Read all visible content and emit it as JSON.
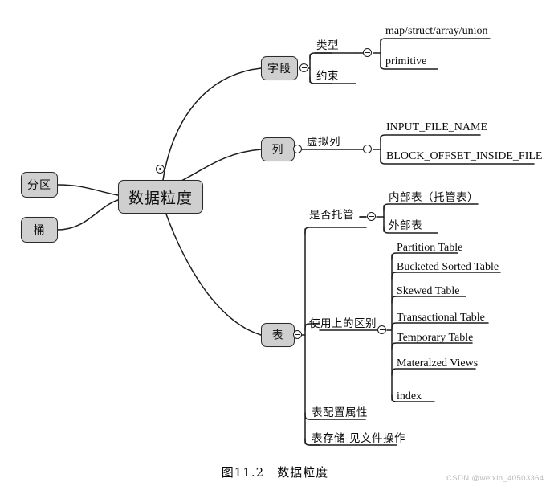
{
  "figure": {
    "caption_number": "图11.2",
    "caption_title": "数据粒度",
    "watermark": "CSDN @weixin_40503364"
  },
  "colors": {
    "node_fill": "#cfcfcf",
    "node_border": "#2b2b2b",
    "line": "#1d1d1d",
    "text": "#0c0c0c",
    "watermark": "#b8b8b8",
    "background": "#ffffff"
  },
  "mindmap": {
    "root": {
      "label": "数据粒度"
    },
    "left_branches": [
      {
        "label": "分区"
      },
      {
        "label": "桶"
      }
    ],
    "right_branches": [
      {
        "label": "字段",
        "children": [
          {
            "label": "类型",
            "children": [
              {
                "label": "map/struct/array/union"
              },
              {
                "label": "primitive"
              }
            ]
          },
          {
            "label": "约束",
            "children": []
          }
        ]
      },
      {
        "label": "列",
        "children": [
          {
            "label": "虚拟列",
            "children": [
              {
                "label": "INPUT_FILE_NAME"
              },
              {
                "label": "BLOCK_OFFSET_INSIDE_FILE"
              }
            ]
          }
        ]
      },
      {
        "label": "表",
        "children": [
          {
            "label": "是否托管",
            "children": [
              {
                "label": "内部表（托管表）"
              },
              {
                "label": "外部表"
              }
            ]
          },
          {
            "label": "使用上的区别",
            "children": [
              {
                "label": "Partition Table"
              },
              {
                "label": "Bucketed Sorted Table"
              },
              {
                "label": "Skewed Table"
              },
              {
                "label": "Transactional Table"
              },
              {
                "label": "Temporary Table"
              },
              {
                "label": "Materalzed Views"
              },
              {
                "label": "index"
              }
            ]
          },
          {
            "label": "表配置属性",
            "children": []
          },
          {
            "label": "表存储-见文件操作",
            "children": []
          }
        ]
      }
    ]
  }
}
